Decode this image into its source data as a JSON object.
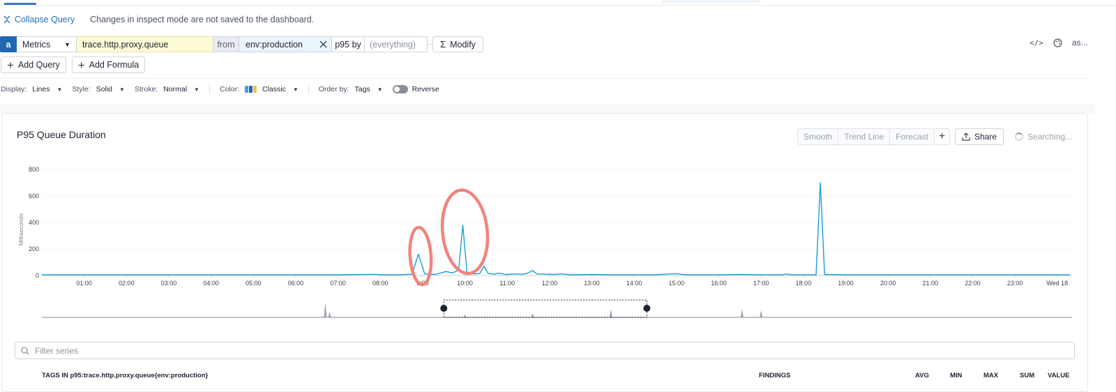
{
  "header": {
    "collapse_label": "Collapse Query",
    "note": "Changes in inspect mode are not saved to the dashboard."
  },
  "query": {
    "letter": "a",
    "source": "Metrics",
    "metric": "trace.http.proxy.queue",
    "from_label": "from",
    "scope": "env:production",
    "aggregation": "p95 by",
    "group_placeholder": "(everything)",
    "modify_label": "Modify"
  },
  "right_tools": {
    "more_label": "as..."
  },
  "add": {
    "query_label": "Add Query",
    "formula_label": "Add Formula"
  },
  "display": {
    "display_label": "Display:",
    "display_value": "Lines",
    "style_label": "Style:",
    "style_value": "Solid",
    "stroke_label": "Stroke:",
    "stroke_value": "Normal",
    "color_label": "Color:",
    "color_value": "Classic",
    "order_label": "Order by:",
    "order_value": "Tags",
    "reverse_label": "Reverse",
    "swatch_colors": [
      "#4c9ae0",
      "#1f67b3",
      "#f2c14e"
    ]
  },
  "chart_title": "P95 Queue Duration",
  "toolbar": {
    "smooth": "Smooth",
    "trend": "Trend Line",
    "forecast": "Forecast",
    "share": "Share",
    "searching": "Searching..."
  },
  "chart_data": {
    "type": "line",
    "ylabel": "Milliseconds",
    "ylim": [
      0,
      800
    ],
    "yticks": [
      "0",
      "200",
      "400",
      "600",
      "800"
    ],
    "xtick_labels": [
      "01:00",
      "02:00",
      "03:00",
      "04:00",
      "05:00",
      "06:00",
      "07:00",
      "08:00",
      "9:00",
      "10:00",
      "11:00",
      "12:00",
      "13:00",
      "14:00",
      "15:00",
      "16:00",
      "17:00",
      "18:00",
      "19:00",
      "20:00",
      "21:00",
      "22:00",
      "23:00",
      "Wed 18"
    ],
    "series": [
      {
        "color": "#1a9bd7",
        "points": [
          [
            0.0,
            6
          ],
          [
            1.0,
            6
          ],
          [
            2.0,
            6
          ],
          [
            3.0,
            6
          ],
          [
            4.0,
            6
          ],
          [
            5.0,
            6
          ],
          [
            6.0,
            6
          ],
          [
            7.0,
            6
          ],
          [
            7.9,
            9
          ],
          [
            8.0,
            6
          ],
          [
            8.5,
            6
          ],
          [
            8.75,
            10
          ],
          [
            8.9,
            160
          ],
          [
            9.05,
            12
          ],
          [
            9.3,
            8
          ],
          [
            9.55,
            30
          ],
          [
            9.7,
            20
          ],
          [
            9.85,
            40
          ],
          [
            9.95,
            380
          ],
          [
            10.05,
            20
          ],
          [
            10.2,
            12
          ],
          [
            10.35,
            15
          ],
          [
            10.45,
            70
          ],
          [
            10.55,
            15
          ],
          [
            10.7,
            10
          ],
          [
            10.8,
            18
          ],
          [
            10.95,
            8
          ],
          [
            11.2,
            12
          ],
          [
            11.4,
            10
          ],
          [
            11.5,
            20
          ],
          [
            11.6,
            38
          ],
          [
            11.7,
            12
          ],
          [
            11.9,
            10
          ],
          [
            12.1,
            8
          ],
          [
            12.3,
            12
          ],
          [
            12.5,
            6
          ],
          [
            13.0,
            8
          ],
          [
            13.5,
            6
          ],
          [
            14.0,
            6
          ],
          [
            14.5,
            6
          ],
          [
            15.0,
            14
          ],
          [
            15.2,
            6
          ],
          [
            16.0,
            6
          ],
          [
            16.5,
            8
          ],
          [
            17.0,
            6
          ],
          [
            17.5,
            6
          ],
          [
            17.6,
            12
          ],
          [
            17.7,
            6
          ],
          [
            18.2,
            6
          ],
          [
            18.3,
            6
          ],
          [
            18.4,
            700
          ],
          [
            18.5,
            8
          ],
          [
            19.0,
            6
          ],
          [
            20.0,
            6
          ],
          [
            21.0,
            6
          ],
          [
            22.0,
            6
          ],
          [
            23.0,
            6
          ],
          [
            24.0,
            6
          ],
          [
            24.3,
            6
          ]
        ]
      }
    ],
    "overview_spikes": [
      [
        6.7,
        22
      ],
      [
        6.8,
        8
      ],
      [
        10.0,
        4
      ],
      [
        11.6,
        6
      ],
      [
        13.45,
        12
      ],
      [
        16.55,
        12
      ],
      [
        17.0,
        10
      ]
    ]
  },
  "filter_placeholder": "Filter series",
  "table": {
    "tags_header": "TAGS IN p95:trace.http.proxy.queue{env:production}",
    "findings": "FINDINGS",
    "avg": "AVG",
    "min": "MIN",
    "max": "MAX",
    "sum": "SUM",
    "value": "VALUE"
  }
}
